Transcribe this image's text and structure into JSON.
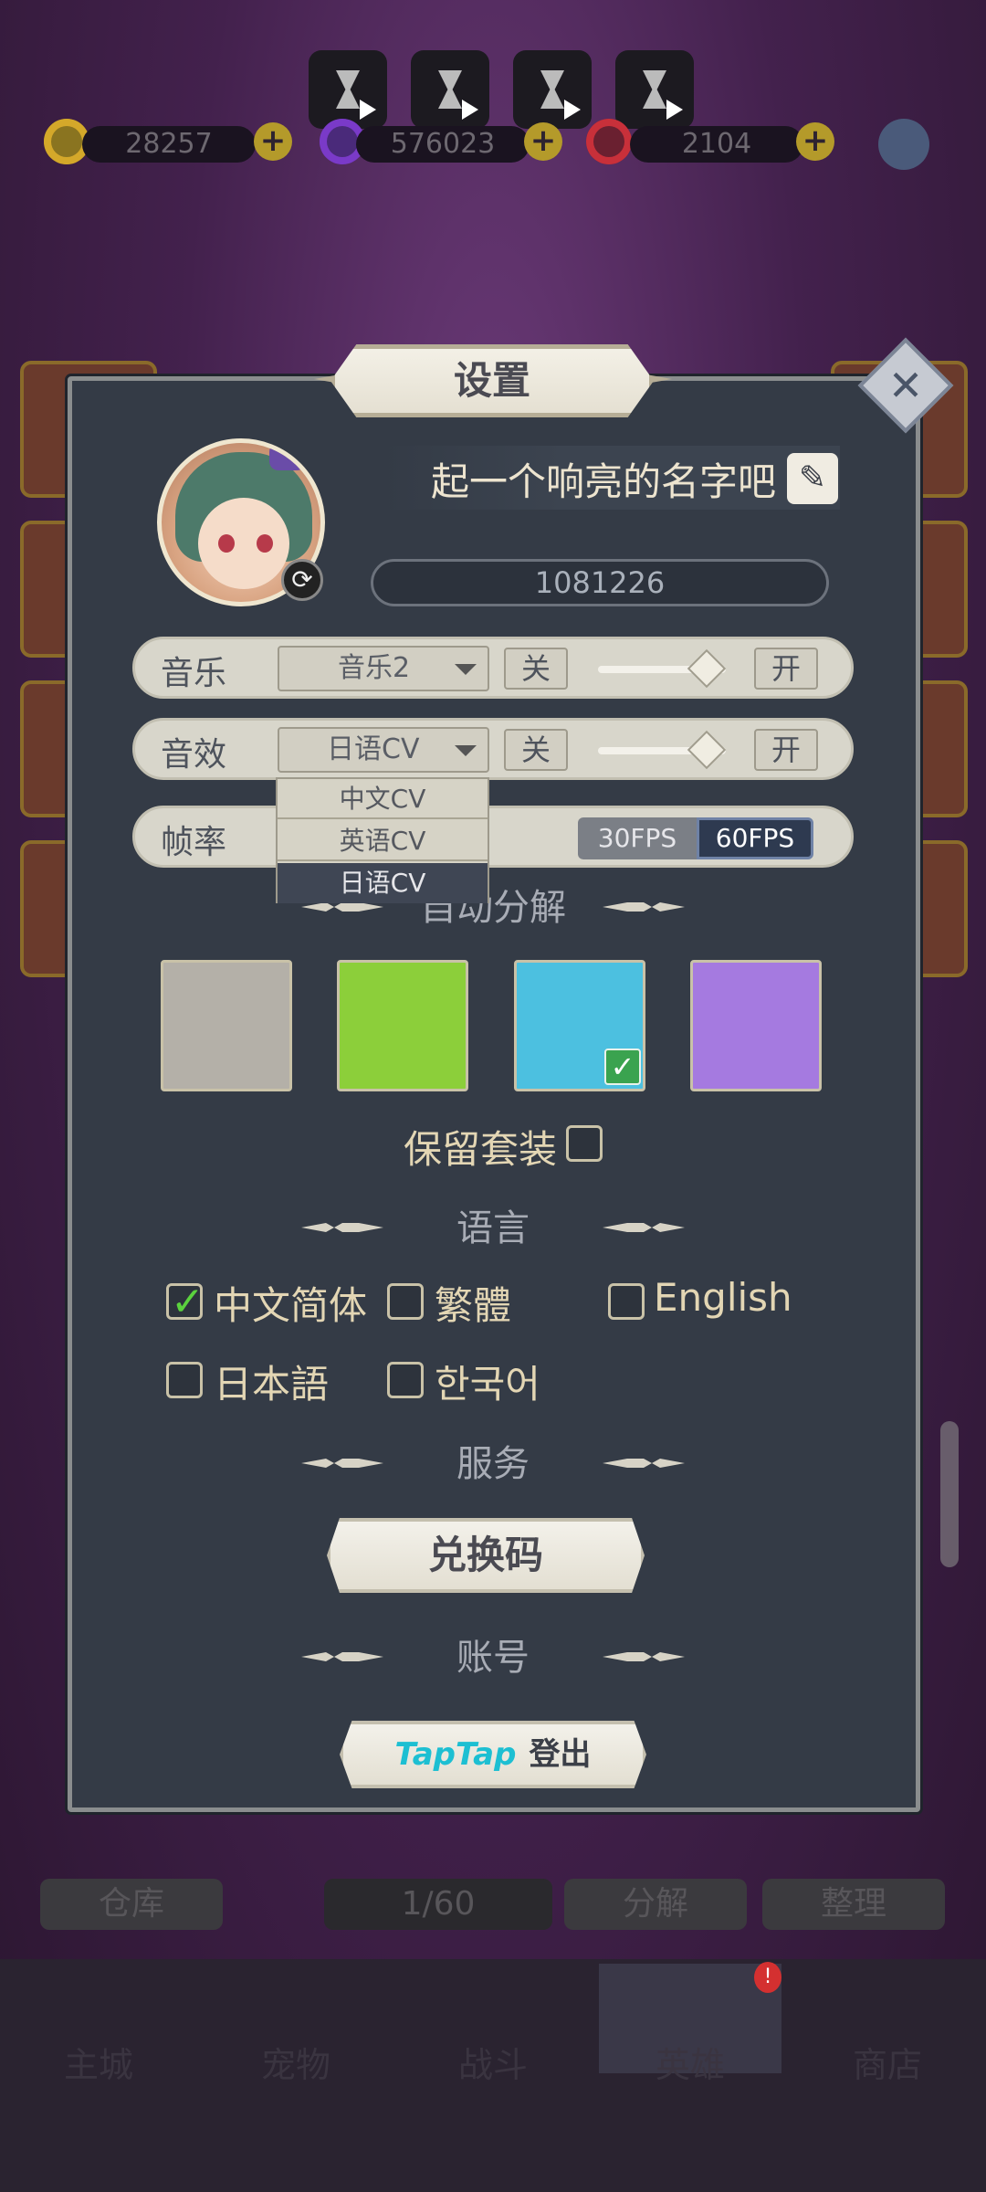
{
  "currencies": [
    {
      "name": "gold",
      "value": "28257",
      "color": "#d4a82a"
    },
    {
      "name": "gem",
      "value": "576023",
      "color": "#7a3ac8"
    },
    {
      "name": "ruby",
      "value": "2104",
      "color": "#c8303a"
    }
  ],
  "background": {
    "bottom_buttons": [
      "仓库",
      "1/60",
      "分解",
      "整理"
    ],
    "nav": [
      "主城",
      "宠物",
      "战斗",
      "英雄",
      "商店"
    ]
  },
  "dialog": {
    "title": "设置",
    "name_placeholder": "起一个响亮的名字吧",
    "player_id": "1081226",
    "music": {
      "label": "音乐",
      "selected": "音乐2",
      "off": "关",
      "on": "开",
      "level": 0.85
    },
    "sfx": {
      "label": "音效",
      "selected": "日语CV",
      "off": "关",
      "on": "开",
      "level": 0.85
    },
    "dropdown_options": [
      "中文CV",
      "英语CV",
      "日语CV"
    ],
    "fps": {
      "label": "帧率",
      "options": [
        "30FPS",
        "60FPS"
      ],
      "selected": "60FPS"
    },
    "auto_decompose": {
      "title": "自动分解",
      "swatches": [
        {
          "name": "gray",
          "color": "#b4b0a8",
          "checked": false
        },
        {
          "name": "green",
          "color": "#8ccf3a",
          "checked": false
        },
        {
          "name": "blue",
          "color": "#4cc0e0",
          "checked": true
        },
        {
          "name": "purple",
          "color": "#a57ae0",
          "checked": false
        }
      ],
      "keep_set_label": "保留套装"
    },
    "language": {
      "title": "语言",
      "options": [
        {
          "label": "中文简体",
          "checked": true
        },
        {
          "label": "繁體",
          "checked": false
        },
        {
          "label": "English",
          "checked": false
        },
        {
          "label": "日本語",
          "checked": false
        },
        {
          "label": "한국어",
          "checked": false
        }
      ]
    },
    "service": {
      "title": "服务",
      "redeem_label": "兑换码"
    },
    "account": {
      "title": "账号",
      "provider": "TapTap",
      "logout_label": "登出"
    }
  }
}
